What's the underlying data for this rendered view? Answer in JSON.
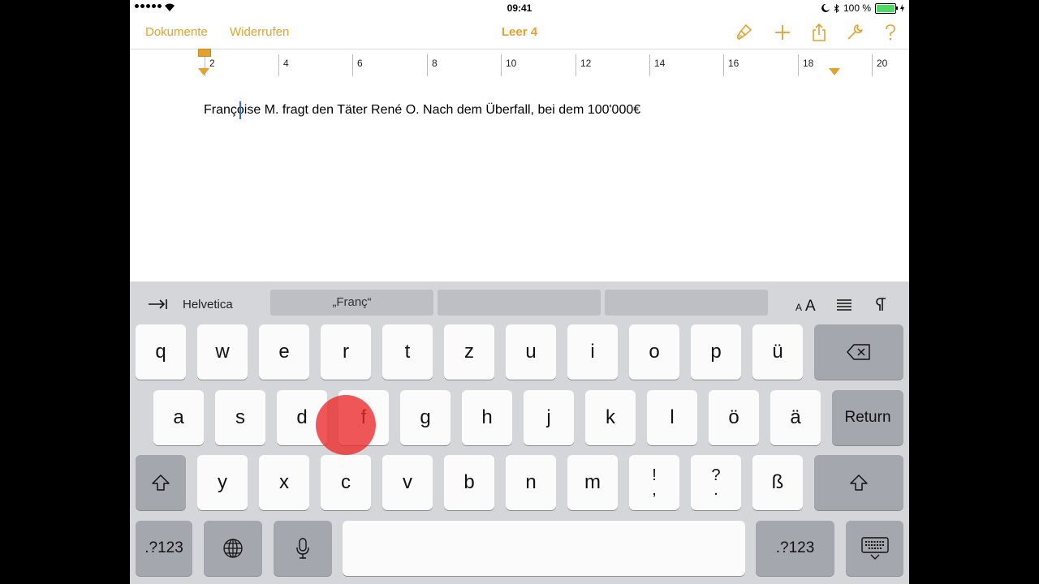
{
  "status_bar": {
    "time": "09:41",
    "battery_text": "100 %"
  },
  "nav": {
    "back_label": "Dokumente",
    "undo_label": "Widerrufen",
    "title": "Leer 4"
  },
  "ruler": {
    "labels": [
      "2",
      "4",
      "6",
      "8",
      "10",
      "12",
      "14",
      "16",
      "18",
      "20"
    ]
  },
  "document": {
    "text": "Françoise M. fragt den Täter René O. Nach dem Überfall, bei dem 100'000€"
  },
  "shortcut_bar": {
    "font_name": "Helvetica",
    "suggestions": [
      "„Franç“",
      "",
      ""
    ]
  },
  "keyboard": {
    "row1": [
      "q",
      "w",
      "e",
      "r",
      "t",
      "z",
      "u",
      "i",
      "o",
      "p",
      "ü"
    ],
    "row2": [
      "a",
      "s",
      "d",
      "f",
      "g",
      "h",
      "j",
      "k",
      "l",
      "ö",
      "ä"
    ],
    "row3": [
      "y",
      "x",
      "c",
      "v",
      "b",
      "n",
      "m"
    ],
    "row3_punct": [
      {
        "top": "!",
        "bottom": ","
      },
      {
        "top": "?",
        "bottom": "."
      }
    ],
    "row3_last": "ß",
    "return_label": "Return",
    "numbers_left": ".?123",
    "numbers_right": ".?123"
  },
  "colors": {
    "accent": "#e3a12f",
    "keyboard_bg": "#d4d6da",
    "touch_indicator": "#ec2828"
  }
}
